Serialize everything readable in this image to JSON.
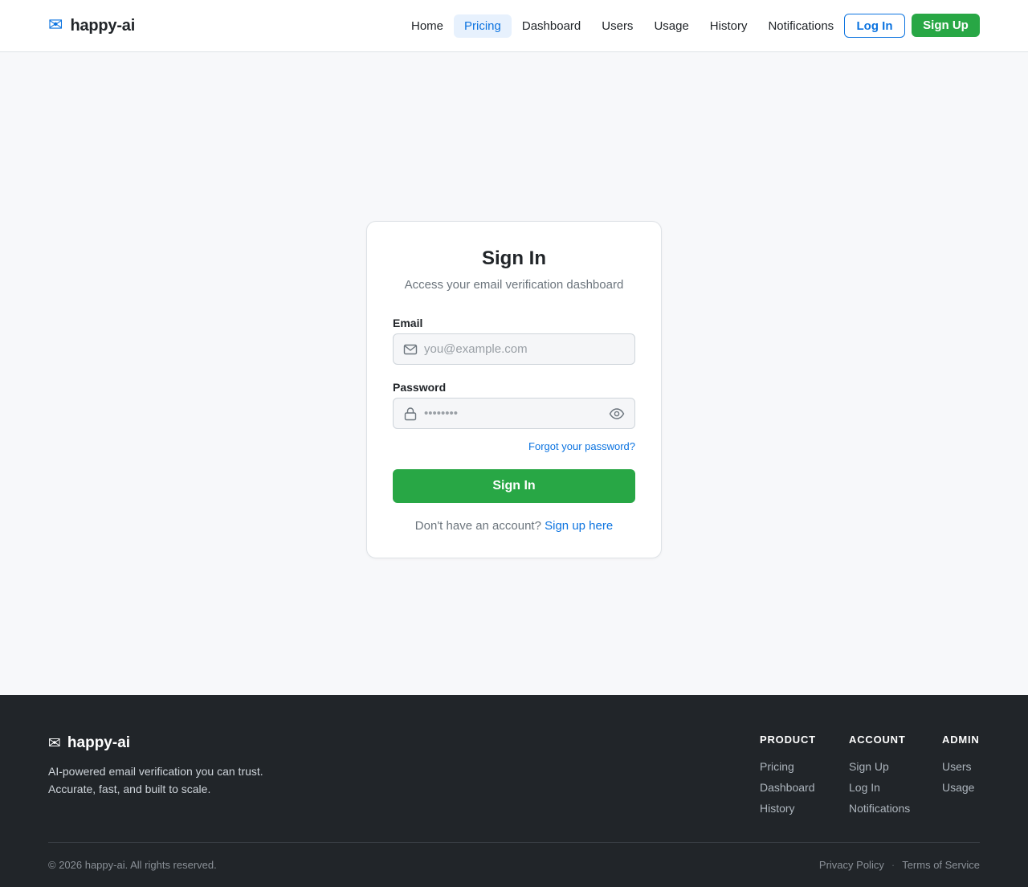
{
  "brand": {
    "icon": "envelope-icon",
    "name": "happy-ai"
  },
  "nav": {
    "items": [
      {
        "label": "Home",
        "active": false
      },
      {
        "label": "Pricing",
        "active": true
      },
      {
        "label": "Dashboard",
        "active": false
      },
      {
        "label": "Users",
        "active": false
      },
      {
        "label": "Usage",
        "active": false
      },
      {
        "label": "History",
        "active": false
      },
      {
        "label": "Notifications",
        "active": false
      }
    ],
    "login_label": "Log In",
    "signup_label": "Sign Up"
  },
  "signin": {
    "title": "Sign In",
    "subtitle": "Access your email verification dashboard",
    "email_label": "Email",
    "email_placeholder": "you@example.com",
    "email_value": "",
    "password_label": "Password",
    "password_placeholder": "••••••••",
    "password_value": "",
    "forgot_label": "Forgot your password?",
    "submit_label": "Sign In",
    "no_account_text": "Don't have an account?",
    "signup_link": "Sign up here"
  },
  "footer": {
    "brand_name": "happy-ai",
    "tagline_line1": "AI-powered email verification you can trust.",
    "tagline_line2": "Accurate, fast, and built to scale.",
    "columns": [
      {
        "heading": "PRODUCT",
        "links": [
          "Pricing",
          "Dashboard",
          "History"
        ]
      },
      {
        "heading": "ACCOUNT",
        "links": [
          "Sign Up",
          "Log In",
          "Notifications"
        ]
      },
      {
        "heading": "ADMIN",
        "links": [
          "Users",
          "Usage"
        ]
      }
    ],
    "copyright": "© 2026 happy-ai. All rights reserved.",
    "privacy_label": "Privacy Policy",
    "separator": "·",
    "terms_label": "Terms of Service"
  },
  "colors": {
    "accent_blue": "#0d74e0",
    "accent_green": "#28a745",
    "footer_bg": "#212529",
    "page_bg": "#f7f8fa"
  }
}
